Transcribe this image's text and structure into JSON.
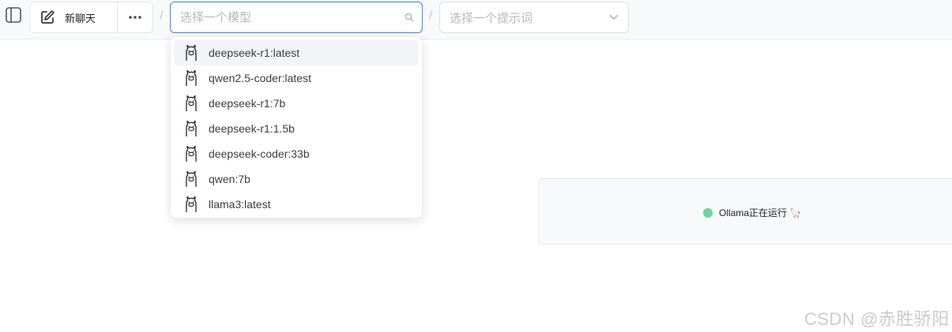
{
  "toolbar": {
    "new_chat_label": "新聊天",
    "separator": "/"
  },
  "model_select": {
    "placeholder": "选择一个模型",
    "icon": "search-icon"
  },
  "prompt_select": {
    "placeholder": "选择一个提示词",
    "icon": "chevron-down-icon"
  },
  "models": [
    {
      "name": "deepseek-r1:latest"
    },
    {
      "name": "qwen2.5-coder:latest"
    },
    {
      "name": "deepseek-r1:7b"
    },
    {
      "name": "deepseek-r1:1.5b"
    },
    {
      "name": "deepseek-coder:33b"
    },
    {
      "name": "qwen:7b"
    },
    {
      "name": "llama3:latest"
    }
  ],
  "status": {
    "text": "Ollama正在运行",
    "emoji": "🦙",
    "dot_color": "#6ad59a"
  },
  "watermark": "CSDN @赤胜骄阳",
  "colors": {
    "accent": "#3b82f6",
    "topbar_bg": "#f8f9fb"
  }
}
